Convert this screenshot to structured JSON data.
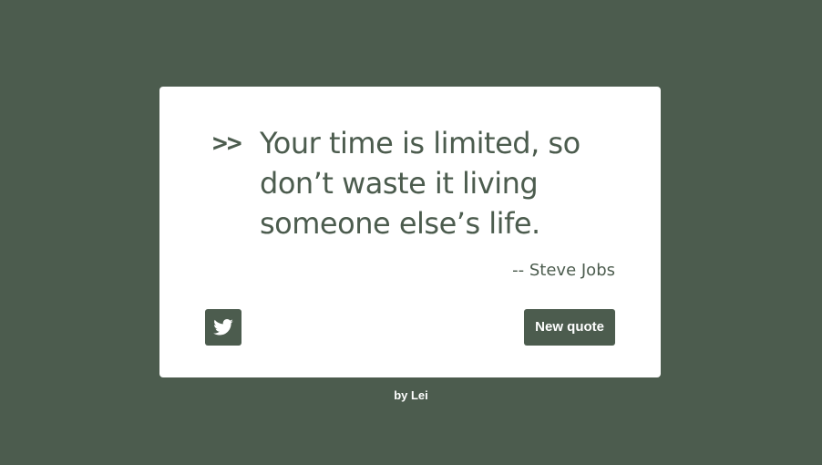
{
  "quote": {
    "mark": ">>",
    "text": "Your time is limited, so don’t waste it living someone else’s life.",
    "author": "-- Steve Jobs"
  },
  "actions": {
    "tweet_icon": "twitter-icon",
    "new_quote_label": "New quote"
  },
  "footer": {
    "credit": "by Lei"
  },
  "colors": {
    "background": "#4c5c4e",
    "card": "#ffffff",
    "accent": "#4c5c4e",
    "button_text": "#ffffff"
  }
}
